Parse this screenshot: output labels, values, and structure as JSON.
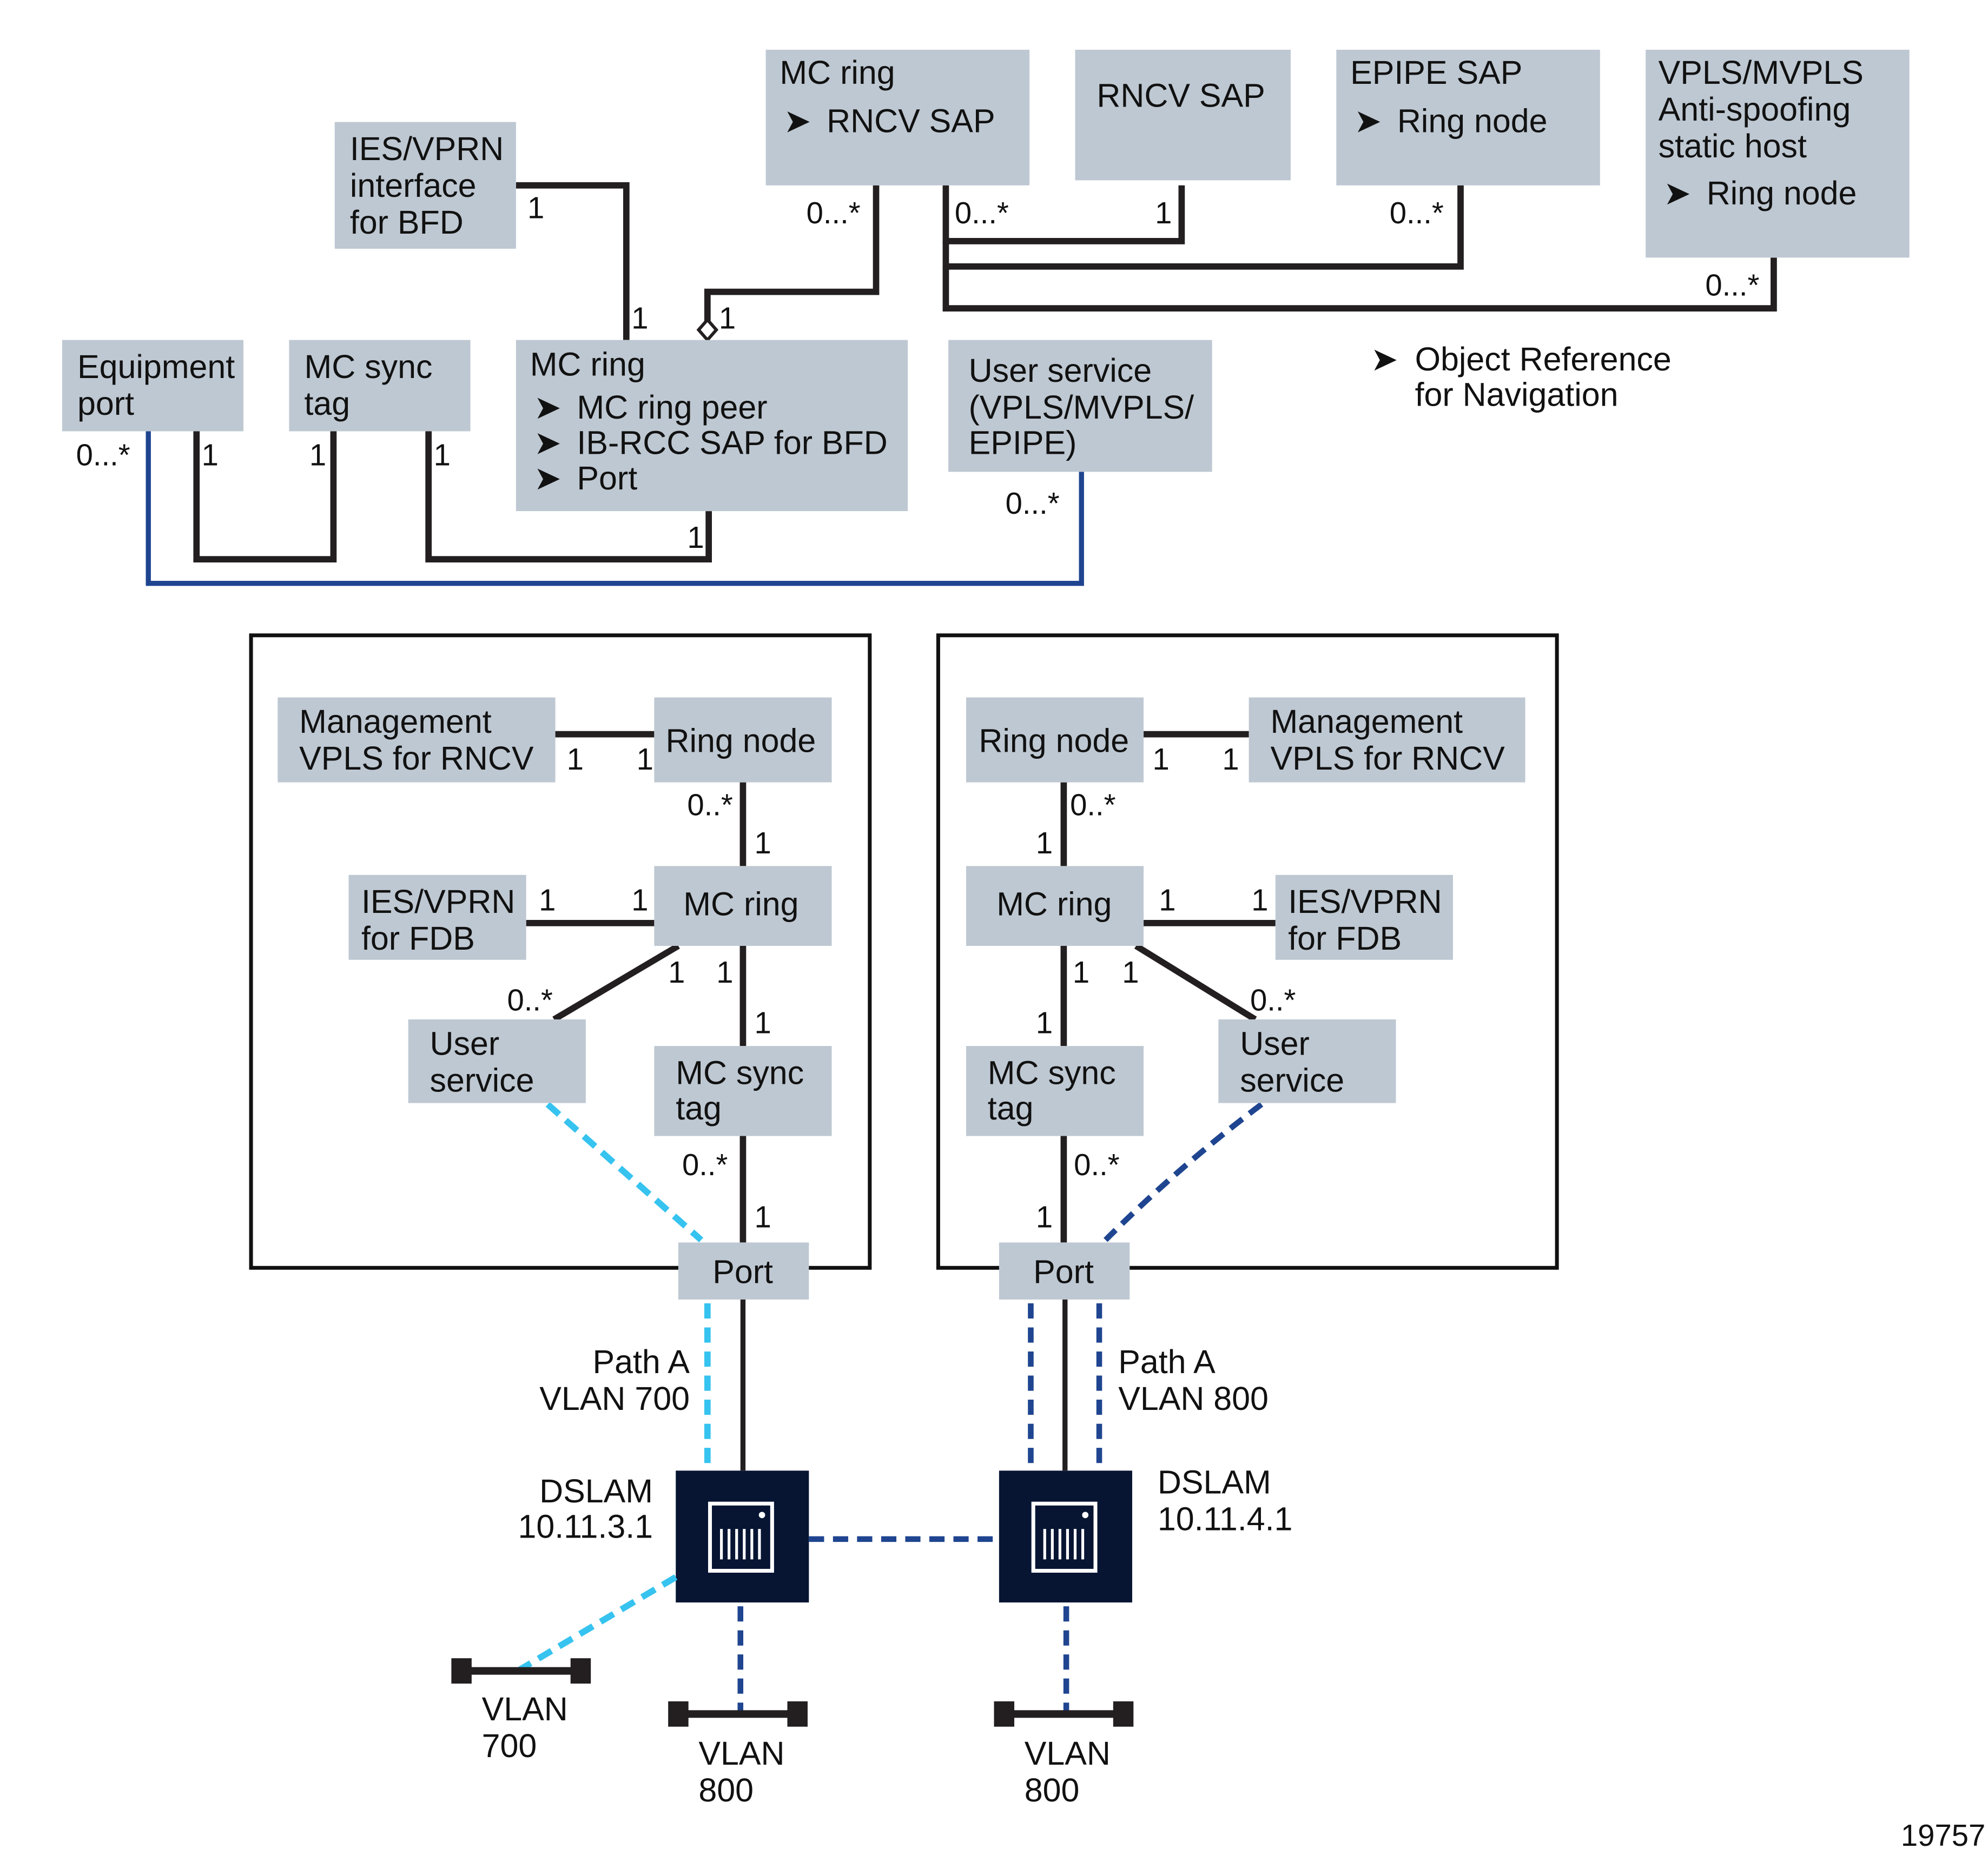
{
  "figure_id": "19757",
  "legend": {
    "arrow": "➤",
    "line1": "Object Reference",
    "line2": "for Navigation"
  },
  "top": {
    "ies_vprn_bfd": [
      "IES/VPRN",
      "interface",
      "for BFD"
    ],
    "mc_ring_rncv": {
      "title": "MC ring",
      "refs": [
        "RNCV SAP"
      ]
    },
    "rncv_sap": "RNCV SAP",
    "epipe_sap": {
      "title": "EPIPE SAP",
      "refs": [
        "Ring node"
      ]
    },
    "vpls_host": {
      "title": [
        "VPLS/MVPLS",
        "Anti-spoofing",
        "static host"
      ],
      "refs": [
        "Ring node"
      ]
    },
    "equipment_port": [
      "Equipment",
      "port"
    ],
    "mc_sync_tag": [
      "MC sync",
      "tag"
    ],
    "mc_ring_main": {
      "title": "MC ring",
      "refs": [
        "MC ring peer",
        "IB-RCC SAP for BFD",
        "Port"
      ]
    },
    "user_service": [
      "User service",
      "(VPLS/MVPLS/",
      "EPIPE)"
    ],
    "mult": {
      "ies_1": "1",
      "mcring_ies_1": "1",
      "mcring_diamond_1": "1",
      "mc_rncv_0": "0...*",
      "rncv_left_0": "0...*",
      "rncv_sap_1": "1",
      "epipe_0": "0...*",
      "vpls_0": "0...*",
      "equip_0": "0...*",
      "equip_1": "1",
      "sync_1a": "1",
      "sync_1b": "1",
      "mcring_bottom_1": "1",
      "user_0": "0...*"
    }
  },
  "left_node": {
    "mgmt": [
      "Management",
      "VPLS for RNCV"
    ],
    "ring_node": "Ring node",
    "ies_fdb": [
      "IES/VPRN",
      "for FDB"
    ],
    "mc_ring": "MC ring",
    "user_service": [
      "User",
      "service"
    ],
    "mc_sync_tag": [
      "MC sync",
      "tag"
    ],
    "port": "Port",
    "mult": [
      "1",
      "1",
      "0..*",
      "1",
      "1",
      "1",
      "1",
      "1",
      "0..*",
      "1",
      "0..*",
      "1"
    ],
    "path": [
      "Path A",
      "VLAN 700"
    ],
    "dslam": [
      "DSLAM",
      "10.11.3.1"
    ],
    "vlans": [
      [
        "VLAN",
        "700"
      ],
      [
        "VLAN",
        "800"
      ]
    ]
  },
  "right_node": {
    "mgmt": [
      "Management",
      "VPLS for RNCV"
    ],
    "ring_node": "Ring node",
    "ies_fdb": [
      "IES/VPRN",
      "for FDB"
    ],
    "mc_ring": "MC ring",
    "user_service": [
      "User",
      "service"
    ],
    "mc_sync_tag": [
      "MC sync",
      "tag"
    ],
    "port": "Port",
    "mult": [
      "1",
      "1",
      "0..*",
      "1",
      "1",
      "1",
      "1",
      "1",
      "0..*",
      "1",
      "0..*",
      "1"
    ],
    "path": [
      "Path A",
      "VLAN 800"
    ],
    "dslam": [
      "DSLAM",
      "10.11.4.1"
    ],
    "vlans": [
      [
        "VLAN",
        "800"
      ]
    ]
  },
  "colors": {
    "box": "#bec8d2",
    "line": "#231f20",
    "blue": "#1f4590",
    "light_blue": "#36c3ef",
    "dslam": "#071533"
  }
}
